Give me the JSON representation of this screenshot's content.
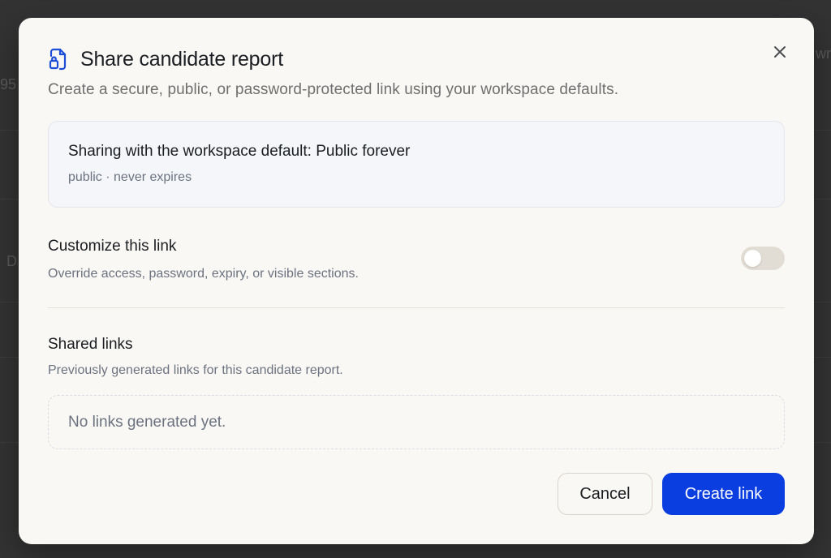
{
  "background": {
    "fragments": [
      "95",
      "D",
      "wn"
    ]
  },
  "dialog": {
    "title": "Share candidate report",
    "subtitle": "Create a secure, public, or password-protected link using your workspace defaults.",
    "title_icon": "file-lock-icon",
    "close_icon": "close-icon"
  },
  "default_card": {
    "title": "Sharing with the workspace default: Public forever",
    "meta": "public · never expires"
  },
  "customize": {
    "title": "Customize this link",
    "description": "Override access, password, expiry, or visible sections.",
    "enabled": false
  },
  "shared_links": {
    "title": "Shared links",
    "description": "Previously generated links for this candidate report.",
    "empty_text": "No links generated yet."
  },
  "footer": {
    "cancel_label": "Cancel",
    "create_label": "Create link"
  },
  "colors": {
    "accent": "#0a3ee0",
    "modal_bg": "#faf8f4",
    "toggle_off": "#e2ddd4"
  }
}
